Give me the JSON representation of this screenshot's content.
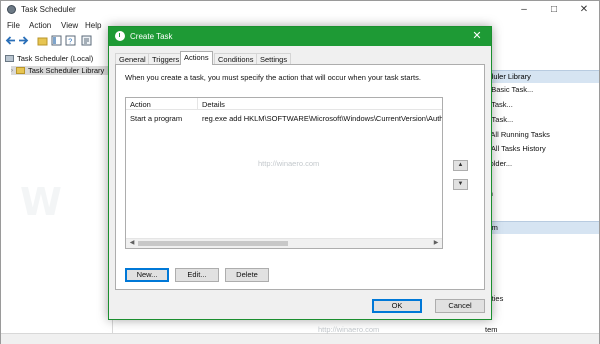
{
  "main_window": {
    "title": "Task Scheduler",
    "menu": [
      "File",
      "Action",
      "View",
      "Help"
    ],
    "tree": {
      "root": "Task Scheduler (Local)",
      "library": "Task Scheduler Library"
    },
    "actions_pane": {
      "header_library": "eduler Library",
      "items": [
        "e Basic Task...",
        "e Task...",
        "rt Task...",
        "y All Running Tasks",
        "e All Tasks History",
        "Folder...",
        "sh",
        "rem"
      ],
      "lower_items": [
        "e",
        "",
        "h",
        "erties",
        "tem"
      ]
    }
  },
  "dialog": {
    "title": "Create Task",
    "tabs": [
      "General",
      "Triggers",
      "Actions",
      "Conditions",
      "Settings"
    ],
    "active_tab": "Actions",
    "description": "When you create a task, you must specify the action that will occur when your task starts.",
    "columns": {
      "action": "Action",
      "details": "Details"
    },
    "rows": [
      {
        "action": "Start a program",
        "details": "reg.exe add HKLM\\SOFTWARE\\Microsoft\\Windows\\CurrentVersion\\Authe"
      }
    ],
    "buttons": {
      "new": "New...",
      "edit": "Edit...",
      "delete": "Delete",
      "ok": "OK",
      "cancel": "Cancel"
    },
    "accent_color": "#1e9a35"
  },
  "watermark": "http://winaero.com"
}
